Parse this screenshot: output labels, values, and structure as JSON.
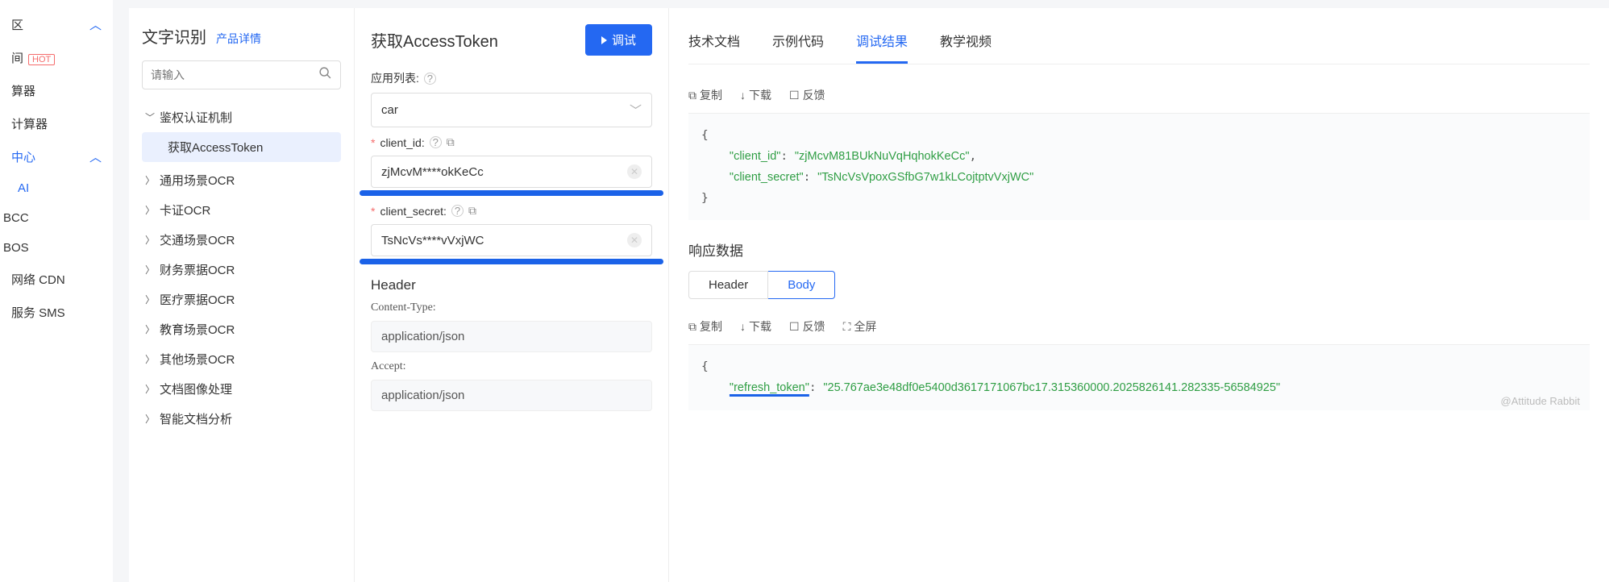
{
  "leftnav": {
    "items": [
      {
        "label": "区",
        "caret": "up"
      },
      {
        "label": "间",
        "hot": "HOT"
      },
      {
        "label": "算器"
      },
      {
        "label": "计算器"
      },
      {
        "label": "中心",
        "active": true,
        "caret": "up"
      },
      {
        "label": "AI",
        "subactive": true
      },
      {
        "label": "BCC"
      },
      {
        "label": "BOS"
      },
      {
        "label": "网络 CDN"
      },
      {
        "label": "服务 SMS"
      }
    ]
  },
  "tree": {
    "title": "文字识别",
    "detail_link": "产品详情",
    "search_placeholder": "请输入",
    "groups": [
      {
        "label": "鉴权认证机制",
        "expanded": true,
        "children": [
          {
            "label": "获取AccessToken",
            "active": true
          }
        ]
      },
      {
        "label": "通用场景OCR"
      },
      {
        "label": "卡证OCR"
      },
      {
        "label": "交通场景OCR"
      },
      {
        "label": "财务票据OCR"
      },
      {
        "label": "医疗票据OCR"
      },
      {
        "label": "教育场景OCR"
      },
      {
        "label": "其他场景OCR"
      },
      {
        "label": "文档图像处理"
      },
      {
        "label": "智能文档分析"
      }
    ]
  },
  "form": {
    "title": "获取AccessToken",
    "debug_btn": "调试",
    "app_list_label": "应用列表:",
    "app_value": "car",
    "client_id_label": "client_id:",
    "client_id_value": "zjMcvM****okKeCc",
    "client_secret_label": "client_secret:",
    "client_secret_value": "TsNcVs****vVxjWC",
    "header_title": "Header",
    "content_type_label": "Content-Type:",
    "content_type_value": "application/json",
    "accept_label": "Accept:",
    "accept_value": "application/json"
  },
  "result": {
    "tabs": [
      "技术文档",
      "示例代码",
      "调试结果",
      "教学视频"
    ],
    "active_tab": 2,
    "toolbar": {
      "copy": "复制",
      "download": "下载",
      "feedback": "反馈",
      "fullscreen": "全屏"
    },
    "request": {
      "client_id_key": "\"client_id\"",
      "client_id_val": "\"zjMcvM81BUkNuVqHqhokKeCc\"",
      "client_secret_key": "\"client_secret\"",
      "client_secret_val": "\"TsNcVsVpoxGSfbG7w1kLCojtptvVxjWC\""
    },
    "response_title": "响应数据",
    "seg": {
      "header": "Header",
      "body": "Body"
    },
    "response": {
      "refresh_token_key": "\"refresh_token\"",
      "refresh_token_val": "\"25.767ae3e48df0e5400d3617171067bc17.315360000.2025826141.282335-56584925\""
    },
    "watermark": "@Attitude Rabbit"
  }
}
